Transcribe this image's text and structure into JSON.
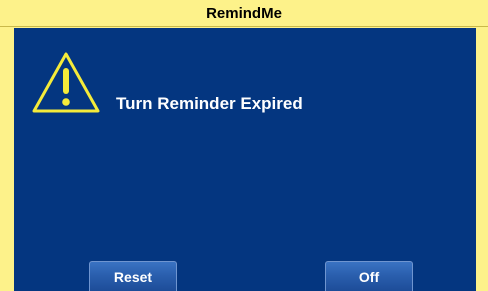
{
  "window": {
    "title": "RemindMe"
  },
  "alert": {
    "icon": "warning-triangle-icon",
    "message": "Turn Reminder Expired"
  },
  "buttons": {
    "reset_label": "Reset",
    "off_label": "Off"
  },
  "colors": {
    "title_bar": "#fdf28a",
    "panel_background": "#043680",
    "warning_icon": "#f5eb3a",
    "button": "#2a5fae"
  }
}
